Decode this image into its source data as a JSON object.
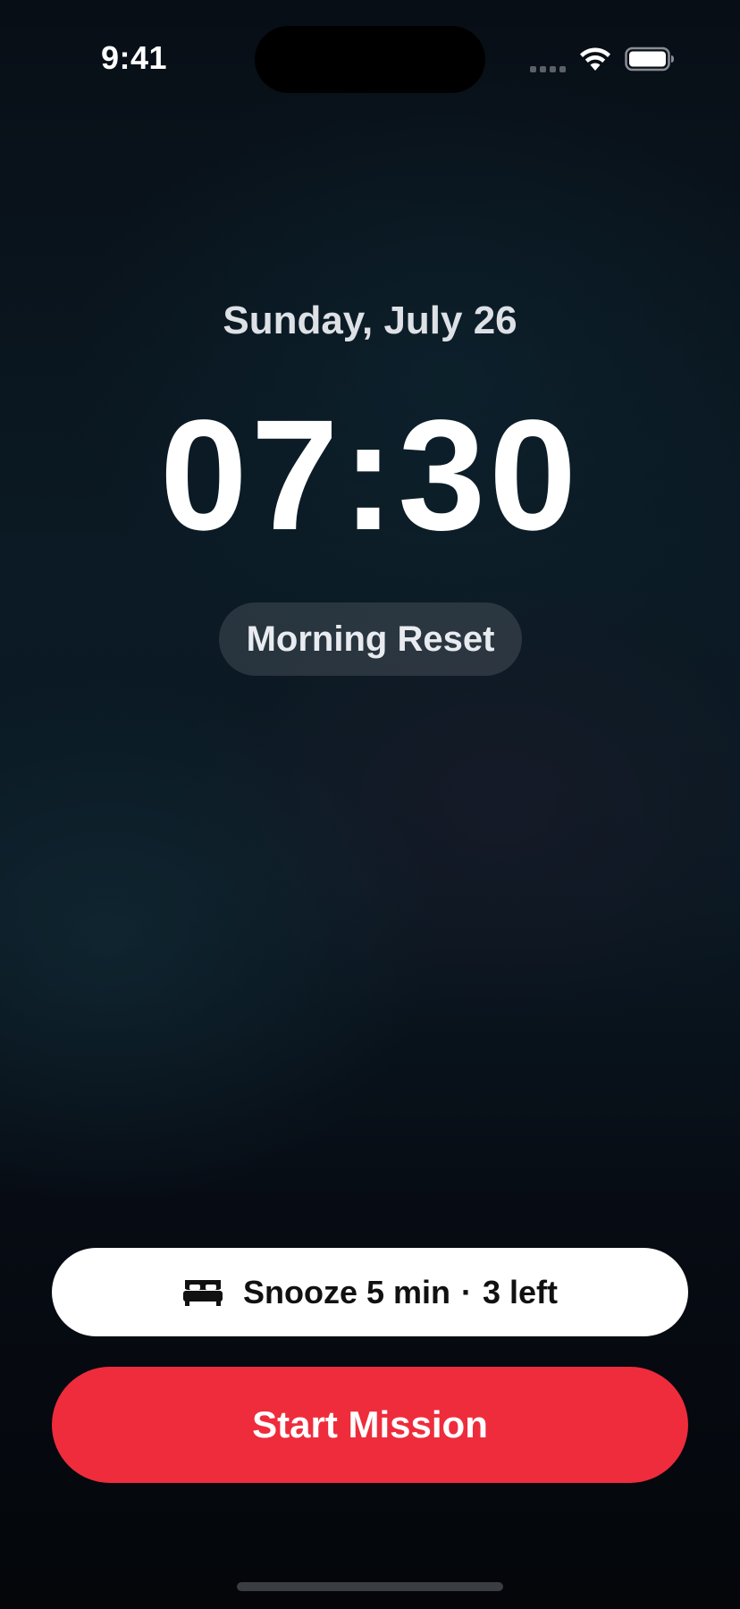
{
  "status_bar": {
    "time": "9:41",
    "wifi_icon": "wifi-icon",
    "battery_icon": "battery-icon"
  },
  "alarm": {
    "date": "Sunday, July 26",
    "time": "07:30",
    "label": "Morning Reset"
  },
  "snooze": {
    "icon": "bed-icon",
    "label": "Snooze 5 min",
    "separator": "·",
    "remaining": "3 left"
  },
  "primary_action": {
    "label": "Start Mission",
    "color": "#ee2c3c"
  }
}
